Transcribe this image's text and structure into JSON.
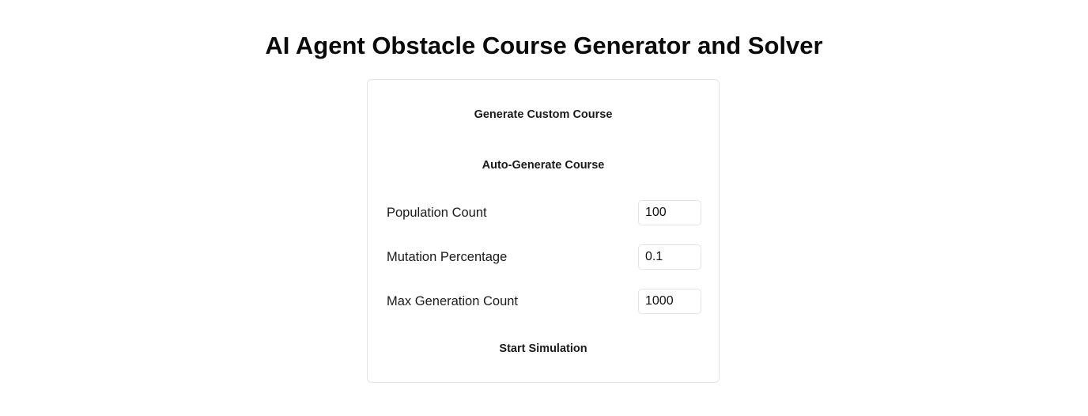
{
  "page": {
    "title": "AI Agent Obstacle Course Generator and Solver"
  },
  "controls": {
    "generate_custom_label": "Generate Custom Course",
    "auto_generate_label": "Auto-Generate Course",
    "start_label": "Start Simulation"
  },
  "fields": {
    "population": {
      "label": "Population Count",
      "value": "100"
    },
    "mutation": {
      "label": "Mutation Percentage",
      "value": "0.1"
    },
    "max_generation": {
      "label": "Max Generation Count",
      "value": "1000"
    }
  }
}
